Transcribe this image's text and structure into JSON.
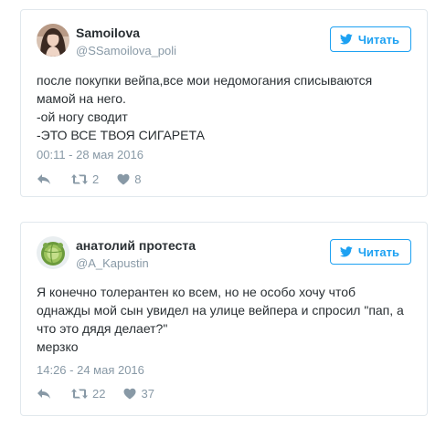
{
  "tweets": [
    {
      "author_name": "Samoilova",
      "author_handle": "@SSamoilova_poli",
      "follow_label": "Читать",
      "text_lines": [
        "после покупки вейпа,все мои недомогания списываются",
        "мамой на него.",
        "-ой ногу сводит",
        "-ЭТО ВСЕ ТВОЯ СИГАРЕТА"
      ],
      "timestamp": "00:11 - 28 мая 2016",
      "retweets": "2",
      "likes": "8",
      "avatar_icon": "person-photo-avatar"
    },
    {
      "author_name": "анатолий протеста",
      "author_handle": "@A_Kapustin",
      "follow_label": "Читать",
      "text_lines": [
        "Я конечно толерантен ко всем, но не особо хочу чтоб",
        "однажды мой сын увидел на улице вейпера и спросил \"пап, а",
        "что это дядя делает?\"",
        "мерзко"
      ],
      "timestamp": "14:26 - 24 мая 2016",
      "retweets": "22",
      "likes": "37",
      "avatar_icon": "cabbage-avatar"
    }
  ],
  "colors": {
    "accent": "#1da1f2",
    "text": "#292f33",
    "muted": "#8899a6",
    "border": "#e1e8ed"
  },
  "icons": [
    "twitter-bird-icon",
    "reply-icon",
    "retweet-icon",
    "heart-icon"
  ]
}
